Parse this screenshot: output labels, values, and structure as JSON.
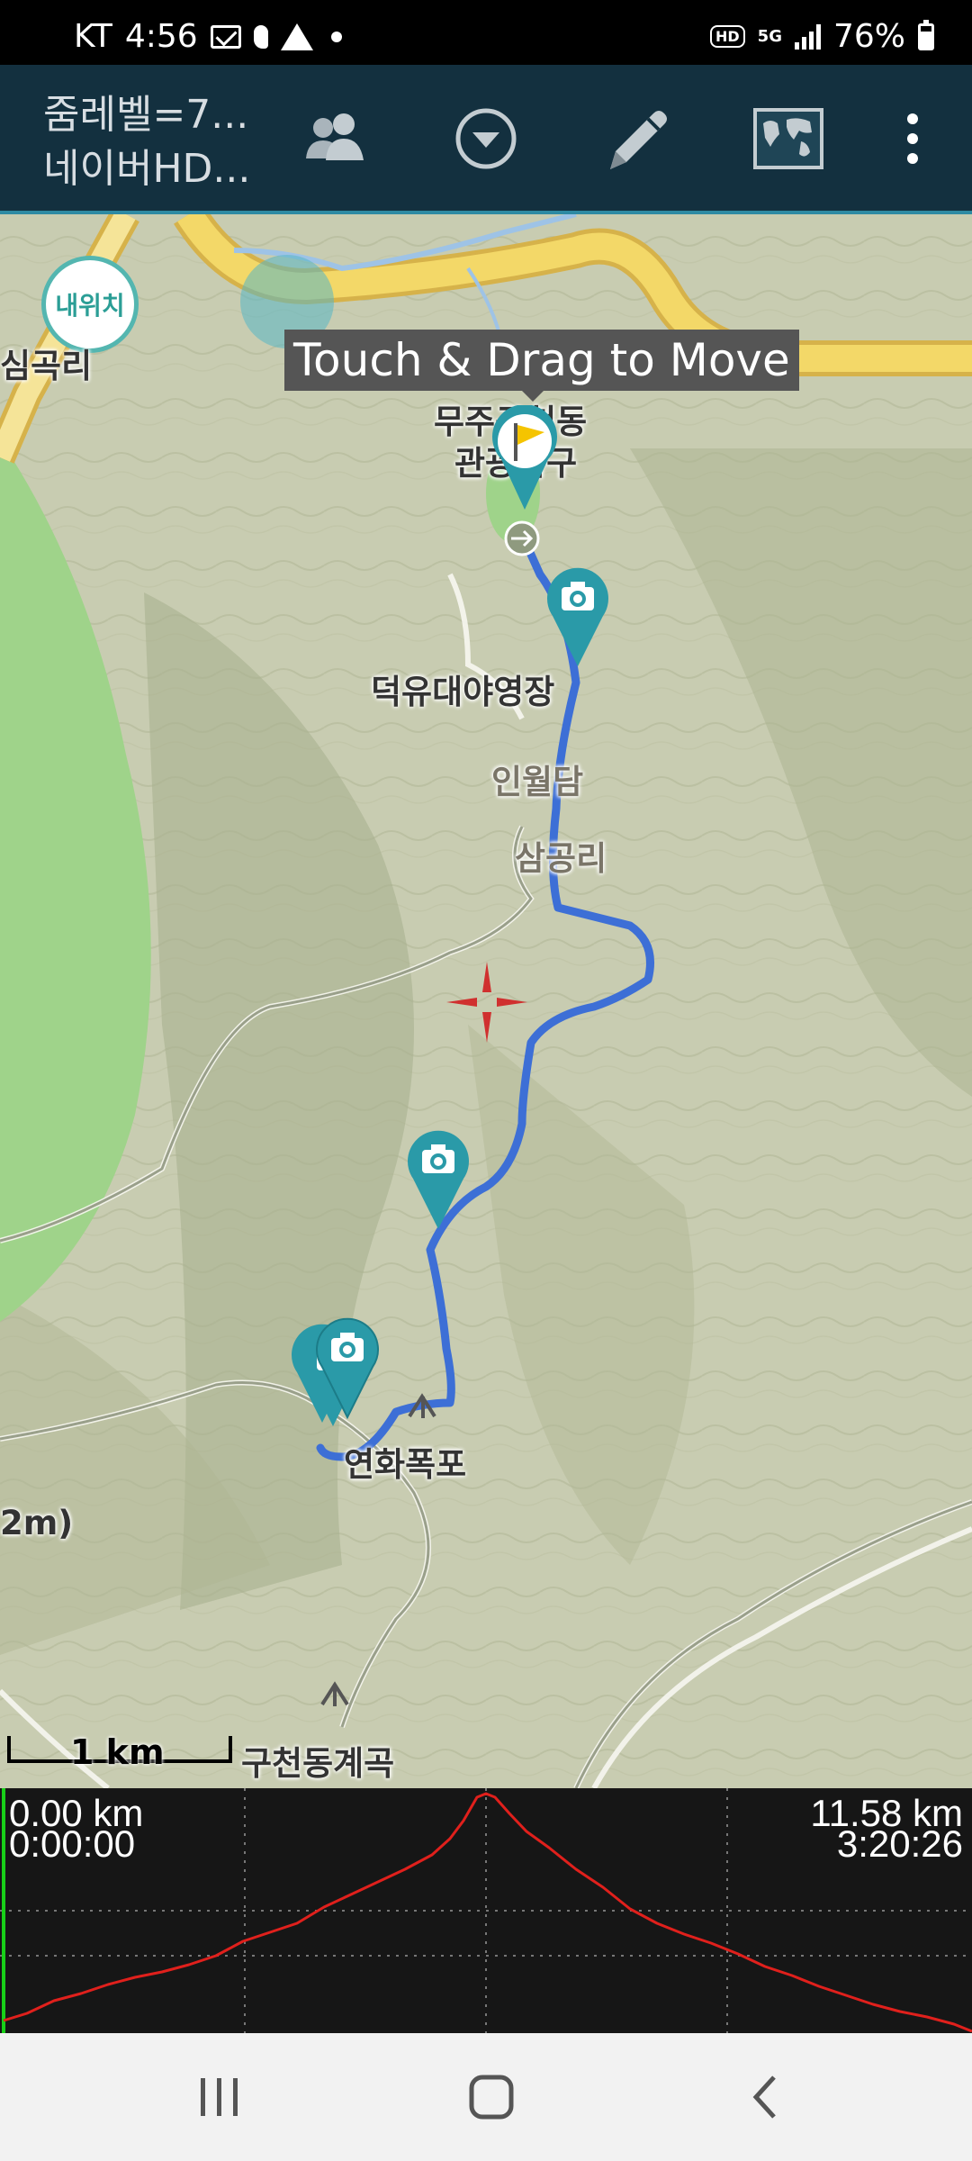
{
  "status_bar": {
    "carrier": "KT",
    "time": "4:56",
    "network": "5G",
    "battery": "76%",
    "icons": [
      "mail-icon",
      "talk-icon",
      "warning-icon",
      "dot-icon",
      "hd-voice-icon",
      "signal-icon",
      "battery-icon"
    ]
  },
  "app_bar": {
    "title_line1": "줌레벨=7...",
    "title_line2": "네이버HD...",
    "buttons": [
      "people-icon",
      "dropdown-circle-icon",
      "pencil-icon",
      "world-map-icon",
      "overflow-menu-icon"
    ]
  },
  "map": {
    "my_location_label": "내위치",
    "tooltip": "Touch & Drag to Move",
    "labels": {
      "samgok_left": "심곡리",
      "gucheon_top": "무주구천동",
      "gucheon_bottom": "관광특구",
      "campsite": "덕유대야영장",
      "inwoldam": "인월담",
      "samgongri": "삼공리",
      "yeonhwa": "연화폭포",
      "elev_partial": "2m)",
      "gyegok": "구천동계곡"
    },
    "scale_label": "1 km",
    "colors": {
      "track": "#3d6fd6",
      "marker": "#2a9aa8",
      "crosshair": "#d0302f",
      "flag": "#f5c400"
    }
  },
  "elevation": {
    "start_distance": "0.00 km",
    "start_time": "0:00:00",
    "end_distance": "11.58 km",
    "end_time": "3:20:26",
    "profile_color": "#e0201c"
  },
  "nav_bar": {
    "buttons": [
      "recent-apps-icon",
      "home-icon",
      "back-icon"
    ]
  }
}
